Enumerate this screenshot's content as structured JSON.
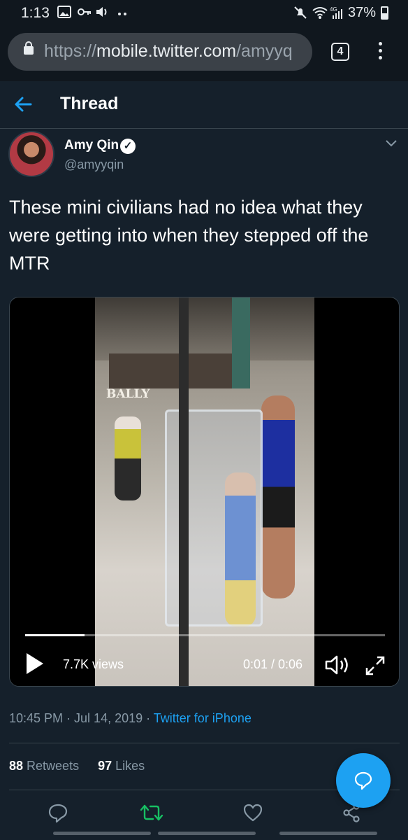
{
  "status": {
    "time": "1:13",
    "battery": "37%",
    "network": "4G"
  },
  "browser": {
    "url_proto": "https://",
    "url_host": "mobile.twitter.com",
    "url_rest": "/amyyq",
    "tab_count": "4"
  },
  "header": {
    "title": "Thread"
  },
  "tweet": {
    "name": "Amy Qin",
    "handle": "@amyyqin",
    "text": "These mini civilians had no idea what they were getting into when they stepped off the MTR",
    "video": {
      "views": "7.7K views",
      "time": "0:01 / 0:06",
      "progress": 0.166
    },
    "date": "10:45 PM · Jul 14, 2019 · ",
    "source": "Twitter for iPhone",
    "retweets_count": "88",
    "retweets_label": " Retweets",
    "likes_count": "97",
    "likes_label": " Likes"
  },
  "colors": {
    "background": "#15202b",
    "accent": "#1da1f2",
    "retweet": "#17bf63",
    "muted": "#8899a6"
  },
  "icons": [
    "back-arrow-icon",
    "verified-icon",
    "chevron-down-icon",
    "play-icon",
    "volume-icon",
    "expand-icon",
    "reply-icon",
    "retweet-icon",
    "like-icon",
    "share-icon",
    "compose-icon"
  ]
}
